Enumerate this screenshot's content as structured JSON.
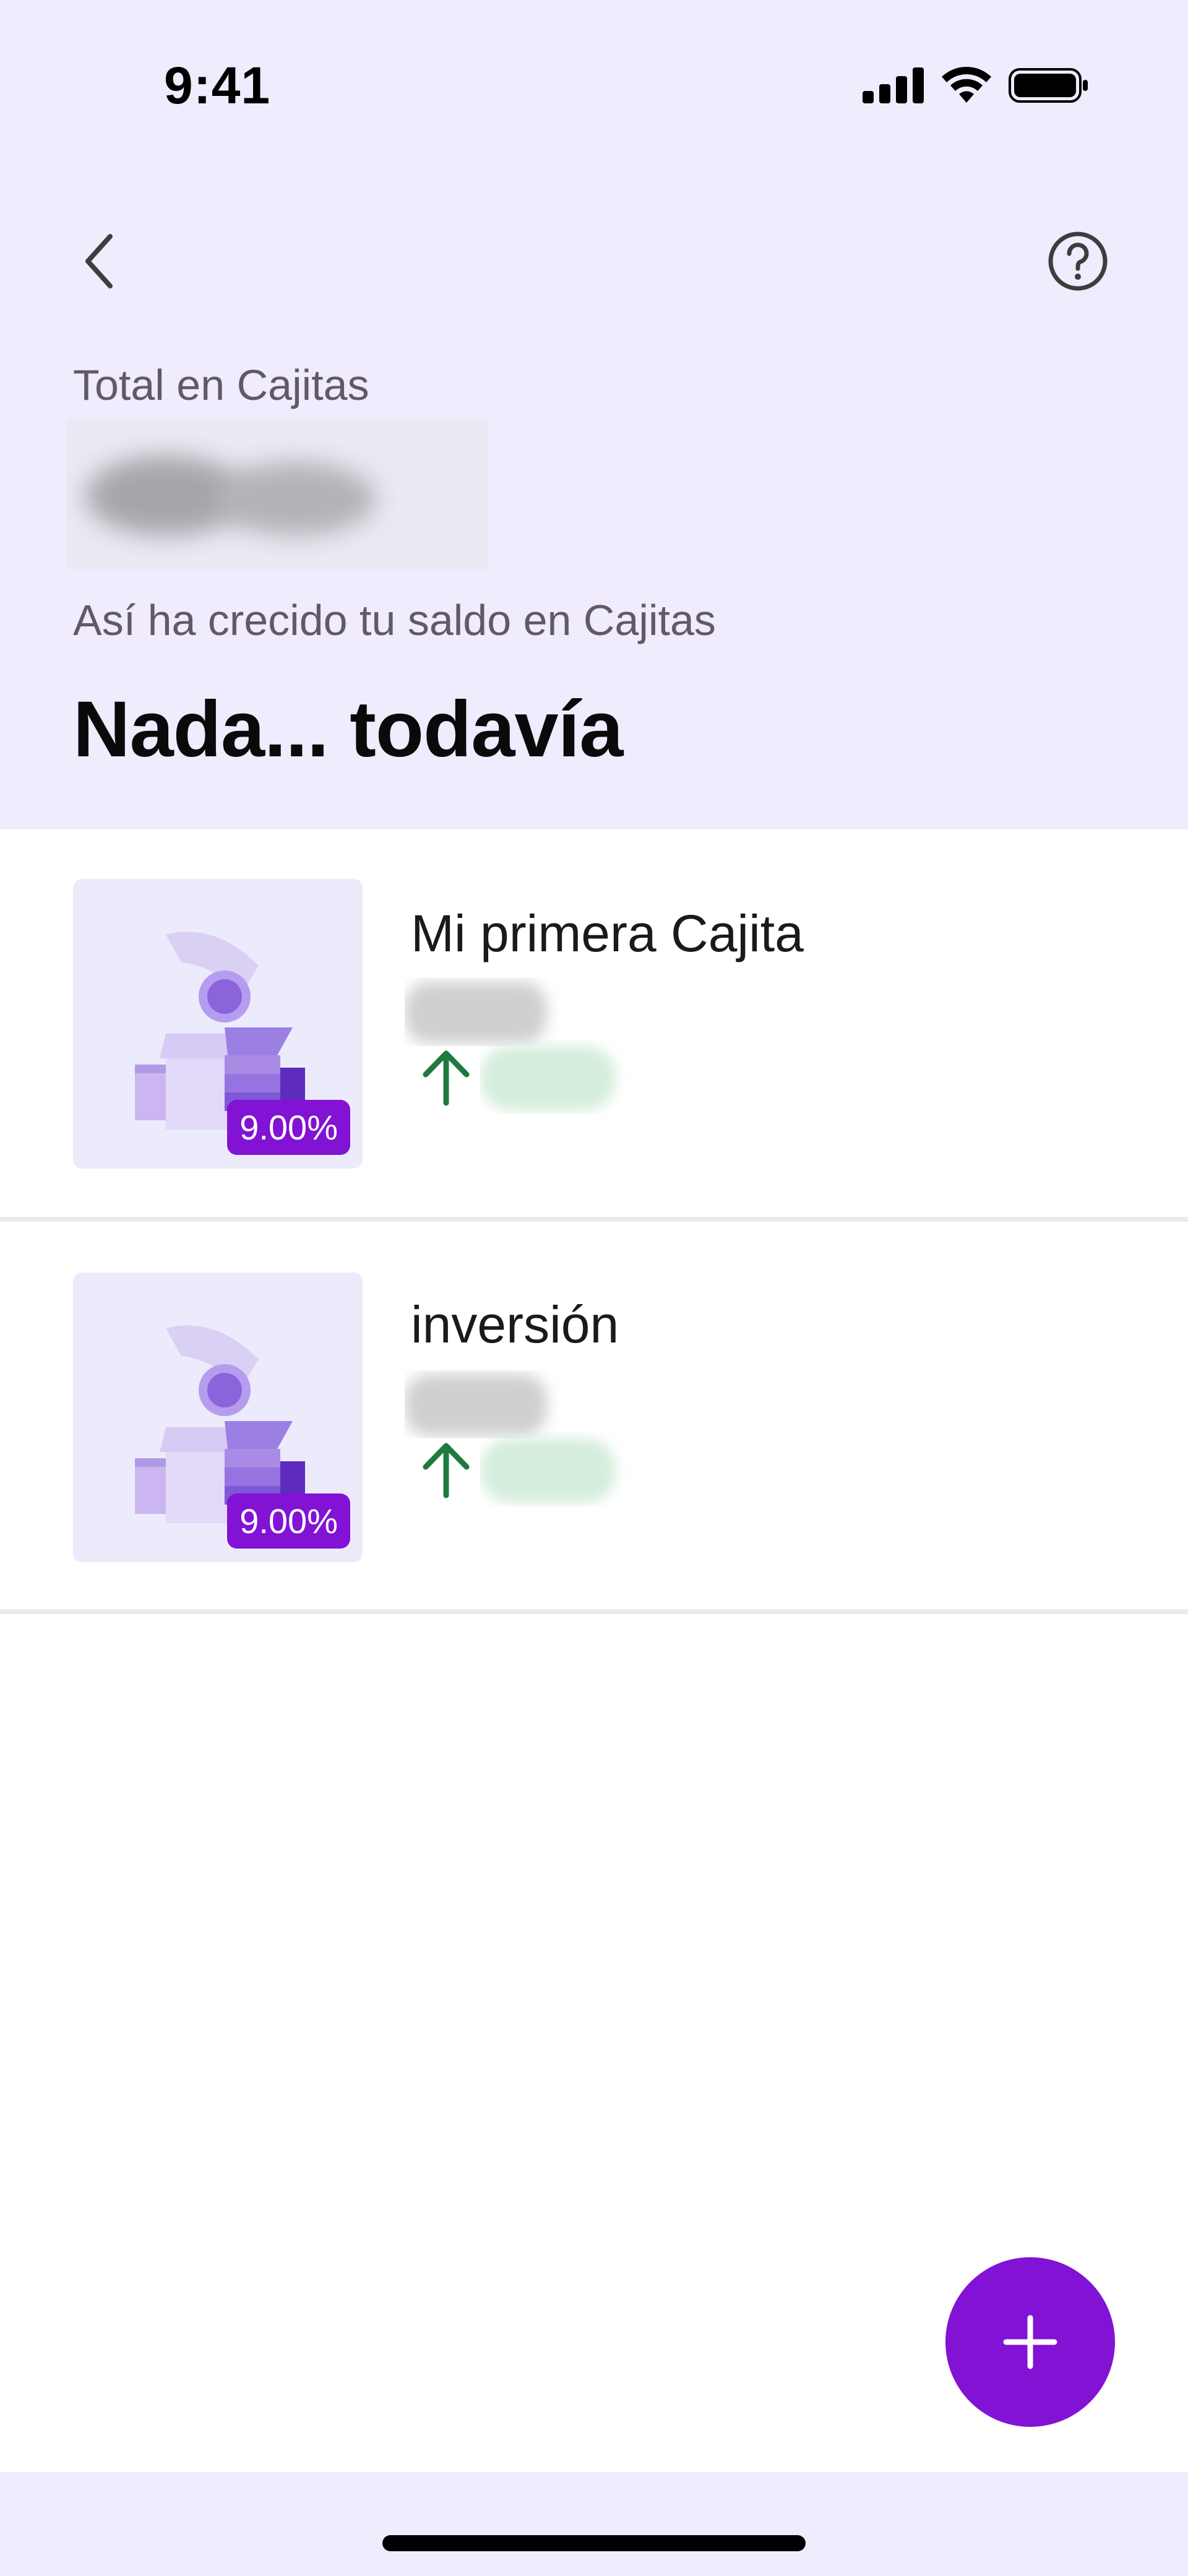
{
  "status_bar": {
    "time": "9:41"
  },
  "header": {
    "total_label": "Total en Cajitas",
    "growth_label": "Así ha crecido tu saldo en Cajitas",
    "growth_value": "Nada... todavía"
  },
  "cajitas": [
    {
      "name": "Mi primera Cajita",
      "rate": "9.00%"
    },
    {
      "name": "inversión",
      "rate": "9.00%"
    }
  ],
  "icons": {
    "back": "back-chevron-icon",
    "help": "help-circle-icon",
    "add": "plus-icon",
    "growth": "arrow-up-icon",
    "thumbnail": "cajita-box-illustration"
  },
  "colors": {
    "header_bg": "#f0ebfd",
    "accent": "#8212d4",
    "growth_green": "#1f7a3f"
  }
}
